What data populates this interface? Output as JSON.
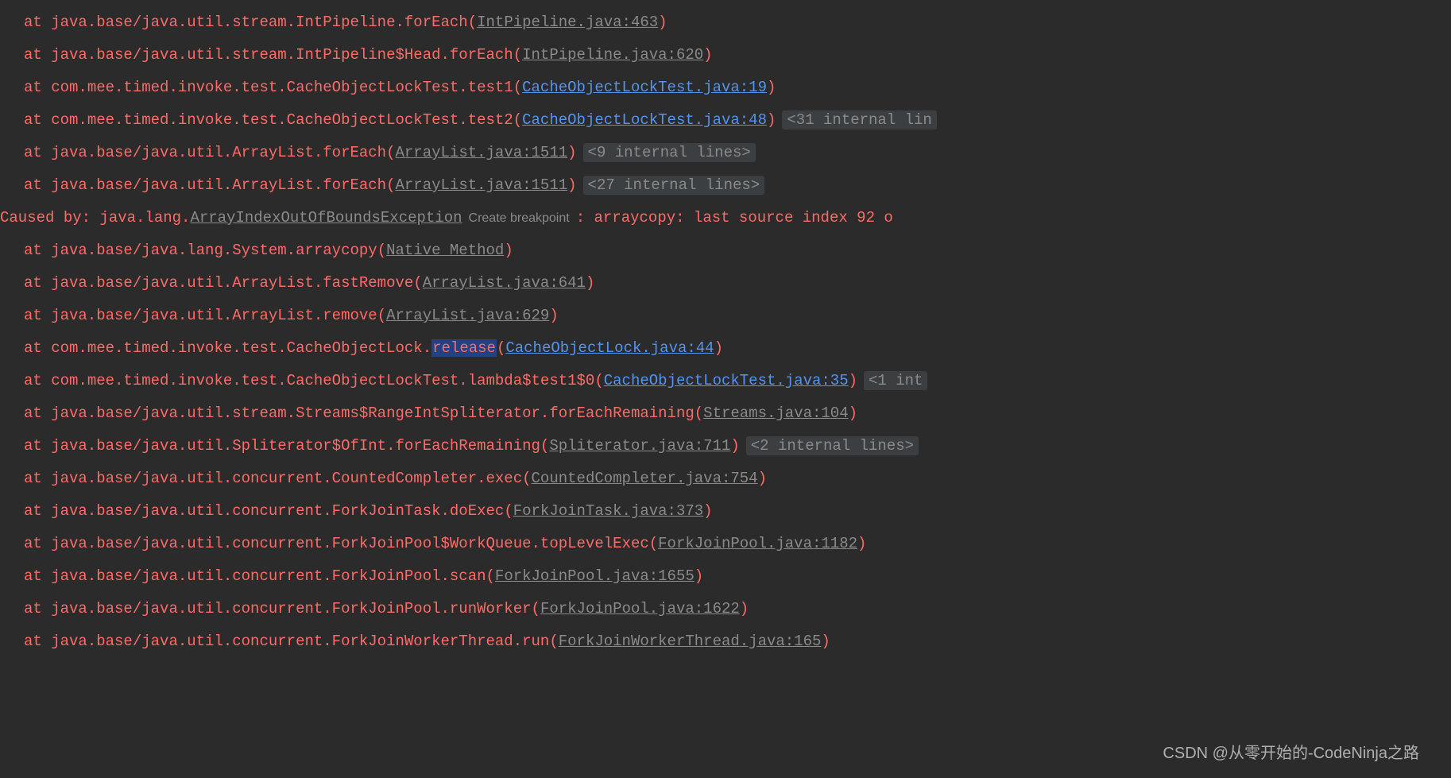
{
  "stack": [
    {
      "at": "at ",
      "loc": "java.base/java.util.stream.IntPipeline.forEach",
      "link": "IntPipeline.java:463",
      "linkType": "gray"
    },
    {
      "at": "at ",
      "loc": "java.base/java.util.stream.IntPipeline$Head.forEach",
      "link": "IntPipeline.java:620",
      "linkType": "gray"
    },
    {
      "at": "at ",
      "loc": "com.mee.timed.invoke.test.CacheObjectLockTest.test1",
      "link": "CacheObjectLockTest.java:19",
      "linkType": "blue"
    },
    {
      "at": "at ",
      "loc": "com.mee.timed.invoke.test.CacheObjectLockTest.test2",
      "link": "CacheObjectLockTest.java:48",
      "linkType": "blue",
      "collapsed": "<31 internal lin"
    },
    {
      "at": "at ",
      "loc": "java.base/java.util.ArrayList.forEach",
      "link": "ArrayList.java:1511",
      "linkType": "gray",
      "collapsed": "<9 internal lines>"
    },
    {
      "at": "at ",
      "loc": "java.base/java.util.ArrayList.forEach",
      "link": "ArrayList.java:1511",
      "linkType": "gray",
      "collapsed": "<27 internal lines>"
    }
  ],
  "caused": {
    "prefix": "Caused by: java.lang.",
    "exception": "ArrayIndexOutOfBoundsException",
    "createBp": "Create breakpoint",
    "message": ": arraycopy: last source index 92 o"
  },
  "stack2": [
    {
      "at": "at ",
      "loc": "java.base/java.lang.System.arraycopy",
      "link": "Native Method",
      "linkType": "gray"
    },
    {
      "at": "at ",
      "loc": "java.base/java.util.ArrayList.fastRemove",
      "link": "ArrayList.java:641",
      "linkType": "gray"
    },
    {
      "at": "at ",
      "loc": "java.base/java.util.ArrayList.remove",
      "link": "ArrayList.java:629",
      "linkType": "gray"
    },
    {
      "at": "at ",
      "loc": "com.mee.timed.invoke.test.CacheObjectLock.",
      "highlight": "release",
      "link": "CacheObjectLock.java:44",
      "linkType": "blue"
    },
    {
      "at": "at ",
      "loc": "com.mee.timed.invoke.test.CacheObjectLockTest.lambda$test1$0",
      "link": "CacheObjectLockTest.java:35",
      "linkType": "blue",
      "collapsed": "<1 int"
    },
    {
      "at": "at ",
      "loc": "java.base/java.util.stream.Streams$RangeIntSpliterator.forEachRemaining",
      "link": "Streams.java:104",
      "linkType": "gray"
    },
    {
      "at": "at ",
      "loc": "java.base/java.util.Spliterator$OfInt.forEachRemaining",
      "link": "Spliterator.java:711",
      "linkType": "gray",
      "collapsed": "<2 internal lines>"
    },
    {
      "at": "at ",
      "loc": "java.base/java.util.concurrent.CountedCompleter.exec",
      "link": "CountedCompleter.java:754",
      "linkType": "gray"
    },
    {
      "at": "at ",
      "loc": "java.base/java.util.concurrent.ForkJoinTask.doExec",
      "link": "ForkJoinTask.java:373",
      "linkType": "gray"
    },
    {
      "at": "at ",
      "loc": "java.base/java.util.concurrent.ForkJoinPool$WorkQueue.topLevelExec",
      "link": "ForkJoinPool.java:1182",
      "linkType": "gray"
    },
    {
      "at": "at ",
      "loc": "java.base/java.util.concurrent.ForkJoinPool.scan",
      "link": "ForkJoinPool.java:1655",
      "linkType": "gray"
    },
    {
      "at": "at ",
      "loc": "java.base/java.util.concurrent.ForkJoinPool.runWorker",
      "link": "ForkJoinPool.java:1622",
      "linkType": "gray"
    },
    {
      "at": "at ",
      "loc": "java.base/java.util.concurrent.ForkJoinWorkerThread.run",
      "link": "ForkJoinWorkerThread.java:165",
      "linkType": "gray"
    }
  ],
  "watermark": "CSDN @从零开始的-CodeNinja之路"
}
